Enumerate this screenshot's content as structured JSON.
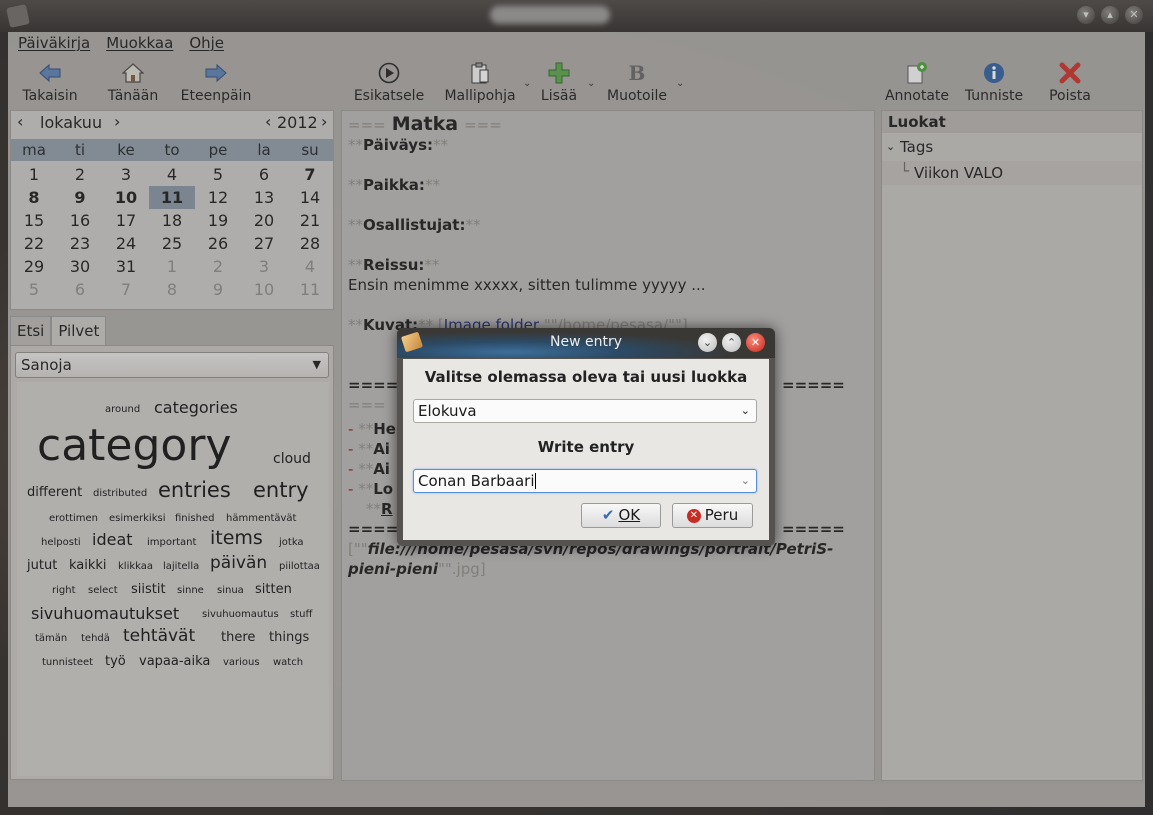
{
  "menu": {
    "items": [
      "Päiväkirja",
      "Muokkaa",
      "Ohje"
    ]
  },
  "toolbar": {
    "back": "Takaisin",
    "today": "Tänään",
    "forward": "Eteenpäin",
    "preview": "Esikatsele",
    "template": "Mallipohja",
    "add": "Lisää",
    "format": "Muotoile",
    "annotate": "Annotate",
    "tag": "Tunniste",
    "delete": "Poista"
  },
  "calendar": {
    "month": "lokakuu",
    "year": "2012",
    "weekdays": [
      "ma",
      "ti",
      "ke",
      "to",
      "pe",
      "la",
      "su"
    ],
    "weeks": [
      [
        "1",
        "2",
        "3",
        "4",
        "5",
        "6",
        "7"
      ],
      [
        "8",
        "9",
        "10",
        "11",
        "12",
        "13",
        "14"
      ],
      [
        "15",
        "16",
        "17",
        "18",
        "19",
        "20",
        "21"
      ],
      [
        "22",
        "23",
        "24",
        "25",
        "26",
        "27",
        "28"
      ],
      [
        "29",
        "30",
        "31",
        "1",
        "2",
        "3",
        "4"
      ],
      [
        "5",
        "6",
        "7",
        "8",
        "9",
        "10",
        "11"
      ]
    ],
    "selected_day": "11"
  },
  "left_tabs": [
    "Etsi",
    "Pilvet"
  ],
  "cloud": {
    "combo_value": "Sanoja",
    "words": [
      "around",
      "categories",
      "category",
      "cloud",
      "different",
      "distributed",
      "entries",
      "entry",
      "erottimen",
      "esimerkiksi",
      "finished",
      "hämmentävät",
      "helposti",
      "ideat",
      "important",
      "items",
      "jotka",
      "jutut",
      "kaikki",
      "klikkaa",
      "lajitella",
      "päivän",
      "piilottaa",
      "right",
      "select",
      "siistit",
      "sinne",
      "sinua",
      "sitten",
      "sivuhuomautukset",
      "sivuhuomautus",
      "stuff",
      "tämän",
      "tehdä",
      "tehtävät",
      "there",
      "things",
      "tunnisteet",
      "työ",
      "vapaa-aika",
      "various",
      "watch"
    ]
  },
  "editor": {
    "heading_mark": "===",
    "heading": "Matka",
    "bold_mark": "**",
    "date_label": "Päiväys:",
    "place_label": "Paikka:",
    "participants_label": "Osallistujat:",
    "trip_label": "Reissu:",
    "trip_text": "Ensin menimme xxxxx, sitten tulimme yyyyy ...",
    "pictures_label": "Kuvat:",
    "image_folder_open": "[",
    "image_folder_link": "Image folder",
    "image_folder_path": "\"\"/home/pesasa/\"\"]",
    "rule": "====",
    "rule2": "=====",
    "sub_mark": "=== ",
    "dash": "-",
    "l1": "He",
    "l2": "Ai",
    "l3": "Ai",
    "l4": "Lo",
    "l5": "R",
    "file_open": "[\"\"",
    "file_path": "file:///home/pesasa/svn/repos/drawings/portrait/PetriS-",
    "file_path2": "pieni-pieni",
    "file_tail": "\"\".jpg]"
  },
  "categories": {
    "header": "Luokat",
    "root": "Tags",
    "child": "Viikon VALO"
  },
  "dialog": {
    "title": "New entry",
    "category_label": "Valitse olemassa oleva tai uusi luokka",
    "category_value": "Elokuva",
    "entry_label": "Write entry",
    "entry_value": "Conan Barbaari",
    "ok": "OK",
    "cancel": "Peru"
  }
}
